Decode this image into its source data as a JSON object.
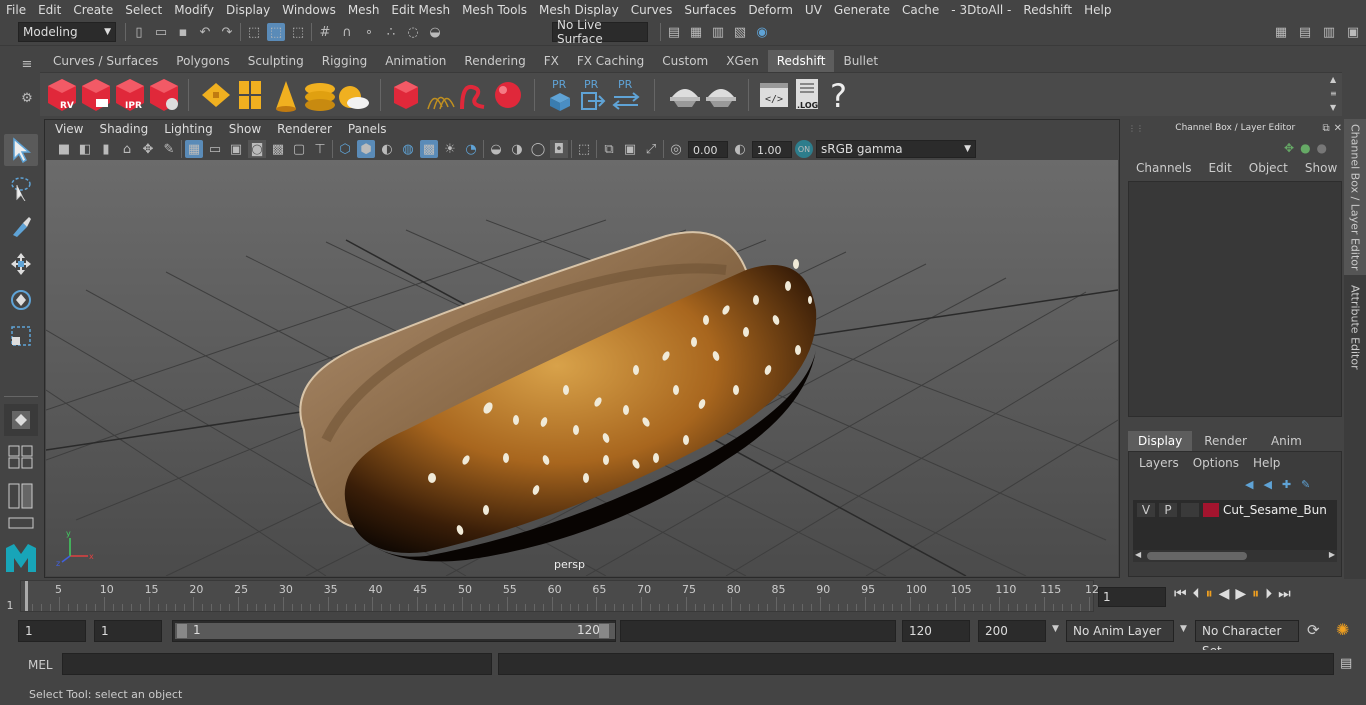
{
  "menubar": {
    "items": [
      "File",
      "Edit",
      "Create",
      "Select",
      "Modify",
      "Display",
      "Windows",
      "Mesh",
      "Edit Mesh",
      "Mesh Tools",
      "Mesh Display",
      "Curves",
      "Surfaces",
      "Deform",
      "UV",
      "Generate",
      "Cache",
      "- 3DtoAll -",
      "Redshift",
      "Help"
    ]
  },
  "statusline": {
    "mode": "Modeling",
    "live_surface": "No Live Surface"
  },
  "shelf": {
    "tabs": [
      "Curves / Surfaces",
      "Polygons",
      "Sculpting",
      "Rigging",
      "Animation",
      "Rendering",
      "FX",
      "FX Caching",
      "Custom",
      "XGen",
      "Redshift",
      "Bullet"
    ],
    "active_tab": "Redshift",
    "icons": {
      "rv": "RV",
      "ipr": "IPR",
      "pr1": "PR",
      "pr2": "PR",
      "pr3": "PR",
      "log": ".LOG",
      "help": "?"
    }
  },
  "viewport": {
    "menus": [
      "View",
      "Shading",
      "Lighting",
      "Show",
      "Renderer",
      "Panels"
    ],
    "exposure": "0.00",
    "gamma": "1.00",
    "color_space": "sRGB gamma",
    "camera_label": "persp"
  },
  "channel_box": {
    "title": "Channel Box / Layer Editor",
    "menus": [
      "Channels",
      "Edit",
      "Object",
      "Show"
    ]
  },
  "layer_editor": {
    "tabs": [
      "Display",
      "Render",
      "Anim"
    ],
    "active_tab": "Display",
    "menus": [
      "Layers",
      "Options",
      "Help"
    ],
    "layer": {
      "visible": "V",
      "playback": "P",
      "name": "Cut_Sesame_Bun",
      "color": "#a3142e"
    }
  },
  "side_tabs": {
    "channel_box": "Channel Box / Layer Editor",
    "attribute_editor": "Attribute Editor"
  },
  "timeline": {
    "ticks": [
      "5",
      "10",
      "15",
      "20",
      "25",
      "30",
      "35",
      "40",
      "45",
      "50",
      "55",
      "60",
      "65",
      "70",
      "75",
      "80",
      "85",
      "90",
      "95",
      "100",
      "105",
      "110",
      "115",
      "12"
    ],
    "start_marker": "1",
    "current_frame": "1"
  },
  "range": {
    "start": "1",
    "playback_start": "1",
    "slider_start": "1",
    "slider_end": "120",
    "playback_end": "120",
    "end": "200",
    "anim_layer": "No Anim Layer",
    "character_set": "No Character Set"
  },
  "cmdline": {
    "label": "MEL"
  },
  "helpline": {
    "text": "Select Tool: select an object"
  },
  "colors": {
    "accent": "#5d5d5d",
    "redshift_red": "#e0283a",
    "highlight_blue": "#5fa3d6",
    "selected_tool": "#5a8bb8"
  }
}
